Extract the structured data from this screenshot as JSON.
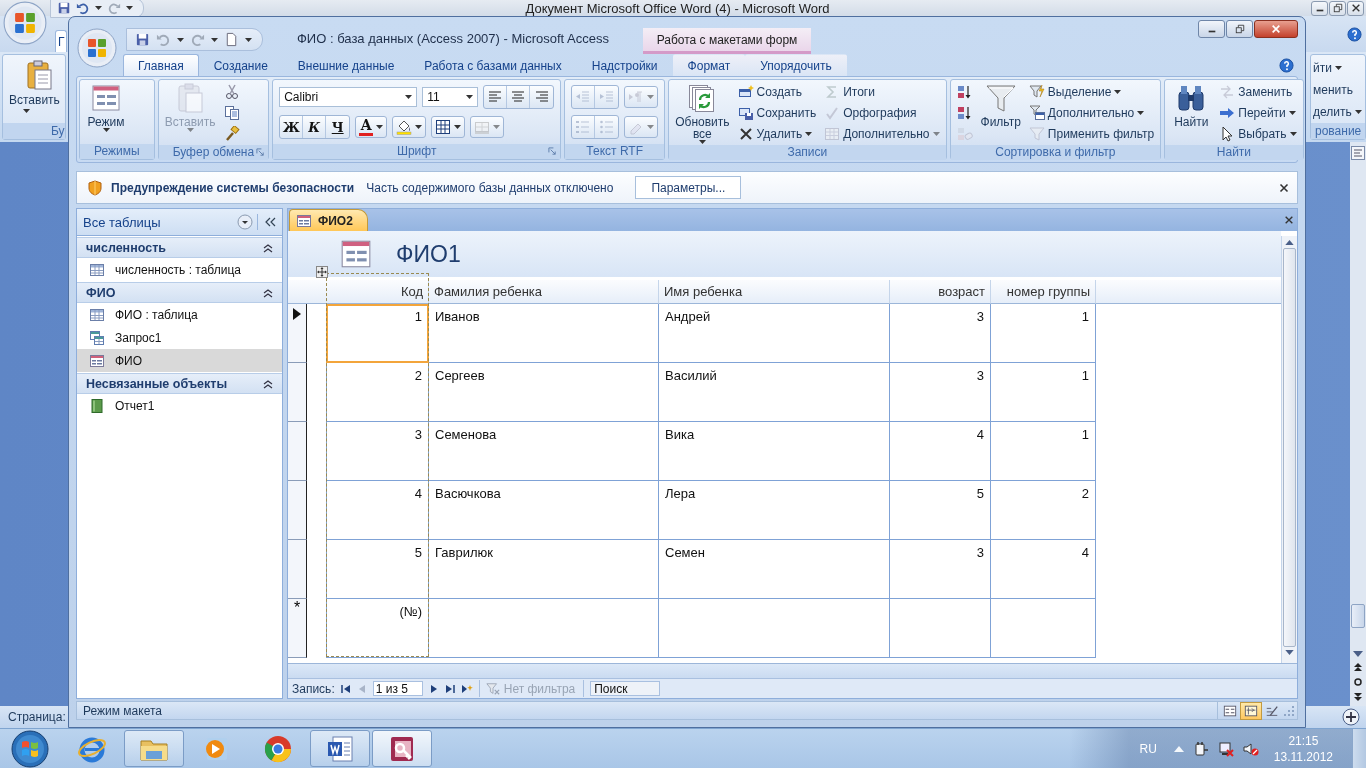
{
  "word_window": {
    "title": "Документ Microsoft Office Word (4)  -  Microsoft Word",
    "tab": "Г",
    "left_button": "Вставить",
    "left_group": "Бу",
    "right_items": [
      {
        "label": "йти",
        "dropdown": true
      },
      {
        "label": "менить",
        "dropdown": false
      },
      {
        "label": "делить",
        "dropdown": true
      }
    ],
    "right_group": "рование",
    "status": "Страница:"
  },
  "access_window": {
    "title": "ФИО : база данных (Access 2007)  -  Microsoft Access",
    "context_title": "Работа с макетами форм"
  },
  "ribbon_tabs": [
    {
      "label": "Главная",
      "selected": true,
      "contextual": false
    },
    {
      "label": "Создание",
      "selected": false,
      "contextual": false
    },
    {
      "label": "Внешние данные",
      "selected": false,
      "contextual": false
    },
    {
      "label": "Работа с базами данных",
      "selected": false,
      "contextual": false
    },
    {
      "label": "Надстройки",
      "selected": false,
      "contextual": false
    },
    {
      "label": "Формат",
      "selected": false,
      "contextual": true
    },
    {
      "label": "Упорядочить",
      "selected": false,
      "contextual": true
    }
  ],
  "ribbon_groups": [
    {
      "label": "Режимы",
      "launcher": false,
      "controls": [
        {
          "kind": "large",
          "label": "Режим",
          "dropdown": true,
          "disabled": false
        }
      ]
    },
    {
      "label": "Буфер обмена",
      "launcher": true,
      "controls": [
        {
          "kind": "large",
          "label": "Вставить",
          "dropdown": true,
          "disabled": true
        },
        {
          "kind": "column",
          "items": [
            {
              "disabled": false
            },
            {
              "disabled": false
            },
            {
              "disabled": false
            }
          ]
        }
      ]
    },
    {
      "label": "Шрифт",
      "launcher": true,
      "rows": [
        [
          {
            "kind": "combo",
            "value": "Calibri"
          },
          {
            "kind": "combo",
            "value": "11"
          },
          {
            "kind": "group",
            "buttons": [
              {
                "disabled": false
              },
              {
                "disabled": false
              },
              {
                "disabled": false
              }
            ]
          }
        ],
        [
          {
            "kind": "group",
            "buttons": [
              {
                "label": "Ж",
                "disabled": false
              },
              {
                "label": "К",
                "disabled": false
              },
              {
                "label": "Ч",
                "disabled": false
              }
            ]
          },
          {
            "kind": "split",
            "label": "A",
            "disabled": false
          },
          {
            "kind": "split",
            "disabled": false
          },
          {
            "kind": "split",
            "disabled": false
          },
          {
            "kind": "split",
            "disabled": true
          }
        ]
      ]
    },
    {
      "label": "Текст RTF",
      "launcher": false,
      "rows": [
        [
          {
            "kind": "group",
            "buttons": [
              {
                "disabled": true
              },
              {
                "disabled": true
              }
            ]
          },
          {
            "kind": "split",
            "disabled": true
          }
        ],
        [
          {
            "kind": "group",
            "buttons": [
              {
                "disabled": true
              },
              {
                "disabled": true
              }
            ]
          },
          {
            "kind": "split",
            "disabled": true
          }
        ]
      ]
    },
    {
      "label": "Записи",
      "launcher": false,
      "controls": [
        {
          "kind": "large",
          "label": "Обновить все",
          "dropdown": true,
          "disabled": false
        },
        {
          "kind": "column",
          "items": [
            {
              "label": "Создать",
              "dropdown": false,
              "disabled": false
            },
            {
              "label": "Сохранить",
              "dropdown": false,
              "disabled": false
            },
            {
              "label": "Удалить",
              "dropdown": true,
              "disabled": false
            }
          ]
        },
        {
          "kind": "column",
          "items": [
            {
              "label": "Итоги",
              "dropdown": false,
              "disabled": true
            },
            {
              "label": "Орфография",
              "dropdown": false,
              "disabled": true
            },
            {
              "label": "Дополнительно",
              "dropdown": true,
              "disabled": true
            }
          ]
        }
      ]
    },
    {
      "label": "Сортировка и фильтр",
      "launcher": false,
      "controls": [
        {
          "kind": "column",
          "items": [
            {
              "disabled": false
            },
            {
              "disabled": false
            },
            {
              "disabled": true
            }
          ]
        },
        {
          "kind": "large",
          "label": "Фильтр",
          "dropdown": false,
          "disabled": false
        },
        {
          "kind": "column",
          "items": [
            {
              "label": "Выделение",
              "dropdown": true,
              "disabled": false
            },
            {
              "label": "Дополнительно",
              "dropdown": true,
              "disabled": false
            },
            {
              "label": "Применить фильтр",
              "dropdown": false,
              "disabled": true
            }
          ]
        }
      ]
    },
    {
      "label": "Найти",
      "launcher": false,
      "controls": [
        {
          "kind": "large",
          "label": "Найти",
          "dropdown": false,
          "disabled": false
        },
        {
          "kind": "column",
          "items": [
            {
              "label": "Заменить",
              "dropdown": false,
              "disabled": true
            },
            {
              "label": "Перейти",
              "dropdown": true,
              "disabled": false
            },
            {
              "label": "Выбрать",
              "dropdown": true,
              "disabled": false
            }
          ]
        }
      ]
    }
  ],
  "security_bar": {
    "title": "Предупреждение системы безопасности",
    "message": "Часть содержимого базы данных отключено",
    "button": "Параметры..."
  },
  "nav_pane": {
    "title": "Все таблицы",
    "groups": [
      {
        "label": "численность",
        "expanded": true,
        "items": [
          {
            "label": "численность : таблица",
            "kind": "table",
            "selected": false
          }
        ]
      },
      {
        "label": "ФИО",
        "expanded": true,
        "items": [
          {
            "label": "ФИО : таблица",
            "kind": "table",
            "selected": false
          },
          {
            "label": "Запрос1",
            "kind": "query",
            "selected": false
          },
          {
            "label": "ФИО",
            "kind": "form",
            "selected": true
          }
        ]
      },
      {
        "label": "Несвязанные объекты",
        "expanded": true,
        "items": [
          {
            "label": "Отчет1",
            "kind": "report",
            "selected": false
          }
        ]
      }
    ]
  },
  "document": {
    "tab": "ФИО2",
    "form_title": "ФИО1",
    "columns": [
      {
        "label": "Код",
        "numeric": true
      },
      {
        "label": "Фамилия ребенка",
        "numeric": false
      },
      {
        "label": "Имя ребенка",
        "numeric": false
      },
      {
        "label": "возраст",
        "numeric": true
      },
      {
        "label": "номер группы",
        "numeric": true
      }
    ],
    "rows": [
      {
        "cells": [
          "1",
          "Иванов",
          "Андрей",
          "3",
          "1"
        ],
        "current": true
      },
      {
        "cells": [
          "2",
          "Сергеев",
          "Василий",
          "3",
          "1"
        ],
        "current": false
      },
      {
        "cells": [
          "3",
          "Семенова",
          "Вика",
          "4",
          "1"
        ],
        "current": false
      },
      {
        "cells": [
          "4",
          "Васючкова",
          "Лера",
          "5",
          "2"
        ],
        "current": false
      },
      {
        "cells": [
          "5",
          "Гаврилюк",
          "Семен",
          "3",
          "4"
        ],
        "current": false
      }
    ],
    "new_row": {
      "marker": "*",
      "code": "(№)"
    }
  },
  "record_nav": {
    "label": "Запись:",
    "position": "1 из 5",
    "filter": "Нет фильтра",
    "placeholder": "Поиск"
  },
  "status_bar": {
    "text": "Режим макета",
    "views": [
      {
        "selected": false
      },
      {
        "selected": true
      },
      {
        "selected": false
      }
    ]
  },
  "taskbar": {
    "apps": [
      {
        "kind": "ie",
        "open": false,
        "active": false
      },
      {
        "kind": "explorer",
        "open": true,
        "active": false
      },
      {
        "kind": "media",
        "open": false,
        "active": false
      },
      {
        "kind": "chrome",
        "open": false,
        "active": false
      },
      {
        "kind": "word",
        "open": true,
        "active": false
      },
      {
        "kind": "access",
        "open": true,
        "active": true
      }
    ],
    "language": "RU",
    "time": "21:15",
    "date": "13.11.2012"
  }
}
